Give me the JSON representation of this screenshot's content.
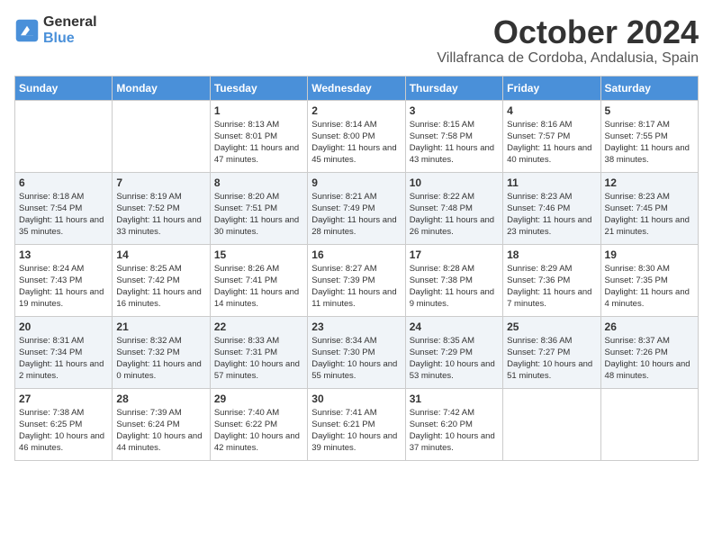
{
  "header": {
    "logo_general": "General",
    "logo_blue": "Blue",
    "month": "October 2024",
    "location": "Villafranca de Cordoba, Andalusia, Spain"
  },
  "weekdays": [
    "Sunday",
    "Monday",
    "Tuesday",
    "Wednesday",
    "Thursday",
    "Friday",
    "Saturday"
  ],
  "weeks": [
    [
      {
        "day": "",
        "sunrise": "",
        "sunset": "",
        "daylight": ""
      },
      {
        "day": "",
        "sunrise": "",
        "sunset": "",
        "daylight": ""
      },
      {
        "day": "1",
        "sunrise": "Sunrise: 8:13 AM",
        "sunset": "Sunset: 8:01 PM",
        "daylight": "Daylight: 11 hours and 47 minutes."
      },
      {
        "day": "2",
        "sunrise": "Sunrise: 8:14 AM",
        "sunset": "Sunset: 8:00 PM",
        "daylight": "Daylight: 11 hours and 45 minutes."
      },
      {
        "day": "3",
        "sunrise": "Sunrise: 8:15 AM",
        "sunset": "Sunset: 7:58 PM",
        "daylight": "Daylight: 11 hours and 43 minutes."
      },
      {
        "day": "4",
        "sunrise": "Sunrise: 8:16 AM",
        "sunset": "Sunset: 7:57 PM",
        "daylight": "Daylight: 11 hours and 40 minutes."
      },
      {
        "day": "5",
        "sunrise": "Sunrise: 8:17 AM",
        "sunset": "Sunset: 7:55 PM",
        "daylight": "Daylight: 11 hours and 38 minutes."
      }
    ],
    [
      {
        "day": "6",
        "sunrise": "Sunrise: 8:18 AM",
        "sunset": "Sunset: 7:54 PM",
        "daylight": "Daylight: 11 hours and 35 minutes."
      },
      {
        "day": "7",
        "sunrise": "Sunrise: 8:19 AM",
        "sunset": "Sunset: 7:52 PM",
        "daylight": "Daylight: 11 hours and 33 minutes."
      },
      {
        "day": "8",
        "sunrise": "Sunrise: 8:20 AM",
        "sunset": "Sunset: 7:51 PM",
        "daylight": "Daylight: 11 hours and 30 minutes."
      },
      {
        "day": "9",
        "sunrise": "Sunrise: 8:21 AM",
        "sunset": "Sunset: 7:49 PM",
        "daylight": "Daylight: 11 hours and 28 minutes."
      },
      {
        "day": "10",
        "sunrise": "Sunrise: 8:22 AM",
        "sunset": "Sunset: 7:48 PM",
        "daylight": "Daylight: 11 hours and 26 minutes."
      },
      {
        "day": "11",
        "sunrise": "Sunrise: 8:23 AM",
        "sunset": "Sunset: 7:46 PM",
        "daylight": "Daylight: 11 hours and 23 minutes."
      },
      {
        "day": "12",
        "sunrise": "Sunrise: 8:23 AM",
        "sunset": "Sunset: 7:45 PM",
        "daylight": "Daylight: 11 hours and 21 minutes."
      }
    ],
    [
      {
        "day": "13",
        "sunrise": "Sunrise: 8:24 AM",
        "sunset": "Sunset: 7:43 PM",
        "daylight": "Daylight: 11 hours and 19 minutes."
      },
      {
        "day": "14",
        "sunrise": "Sunrise: 8:25 AM",
        "sunset": "Sunset: 7:42 PM",
        "daylight": "Daylight: 11 hours and 16 minutes."
      },
      {
        "day": "15",
        "sunrise": "Sunrise: 8:26 AM",
        "sunset": "Sunset: 7:41 PM",
        "daylight": "Daylight: 11 hours and 14 minutes."
      },
      {
        "day": "16",
        "sunrise": "Sunrise: 8:27 AM",
        "sunset": "Sunset: 7:39 PM",
        "daylight": "Daylight: 11 hours and 11 minutes."
      },
      {
        "day": "17",
        "sunrise": "Sunrise: 8:28 AM",
        "sunset": "Sunset: 7:38 PM",
        "daylight": "Daylight: 11 hours and 9 minutes."
      },
      {
        "day": "18",
        "sunrise": "Sunrise: 8:29 AM",
        "sunset": "Sunset: 7:36 PM",
        "daylight": "Daylight: 11 hours and 7 minutes."
      },
      {
        "day": "19",
        "sunrise": "Sunrise: 8:30 AM",
        "sunset": "Sunset: 7:35 PM",
        "daylight": "Daylight: 11 hours and 4 minutes."
      }
    ],
    [
      {
        "day": "20",
        "sunrise": "Sunrise: 8:31 AM",
        "sunset": "Sunset: 7:34 PM",
        "daylight": "Daylight: 11 hours and 2 minutes."
      },
      {
        "day": "21",
        "sunrise": "Sunrise: 8:32 AM",
        "sunset": "Sunset: 7:32 PM",
        "daylight": "Daylight: 11 hours and 0 minutes."
      },
      {
        "day": "22",
        "sunrise": "Sunrise: 8:33 AM",
        "sunset": "Sunset: 7:31 PM",
        "daylight": "Daylight: 10 hours and 57 minutes."
      },
      {
        "day": "23",
        "sunrise": "Sunrise: 8:34 AM",
        "sunset": "Sunset: 7:30 PM",
        "daylight": "Daylight: 10 hours and 55 minutes."
      },
      {
        "day": "24",
        "sunrise": "Sunrise: 8:35 AM",
        "sunset": "Sunset: 7:29 PM",
        "daylight": "Daylight: 10 hours and 53 minutes."
      },
      {
        "day": "25",
        "sunrise": "Sunrise: 8:36 AM",
        "sunset": "Sunset: 7:27 PM",
        "daylight": "Daylight: 10 hours and 51 minutes."
      },
      {
        "day": "26",
        "sunrise": "Sunrise: 8:37 AM",
        "sunset": "Sunset: 7:26 PM",
        "daylight": "Daylight: 10 hours and 48 minutes."
      }
    ],
    [
      {
        "day": "27",
        "sunrise": "Sunrise: 7:38 AM",
        "sunset": "Sunset: 6:25 PM",
        "daylight": "Daylight: 10 hours and 46 minutes."
      },
      {
        "day": "28",
        "sunrise": "Sunrise: 7:39 AM",
        "sunset": "Sunset: 6:24 PM",
        "daylight": "Daylight: 10 hours and 44 minutes."
      },
      {
        "day": "29",
        "sunrise": "Sunrise: 7:40 AM",
        "sunset": "Sunset: 6:22 PM",
        "daylight": "Daylight: 10 hours and 42 minutes."
      },
      {
        "day": "30",
        "sunrise": "Sunrise: 7:41 AM",
        "sunset": "Sunset: 6:21 PM",
        "daylight": "Daylight: 10 hours and 39 minutes."
      },
      {
        "day": "31",
        "sunrise": "Sunrise: 7:42 AM",
        "sunset": "Sunset: 6:20 PM",
        "daylight": "Daylight: 10 hours and 37 minutes."
      },
      {
        "day": "",
        "sunrise": "",
        "sunset": "",
        "daylight": ""
      },
      {
        "day": "",
        "sunrise": "",
        "sunset": "",
        "daylight": ""
      }
    ]
  ]
}
